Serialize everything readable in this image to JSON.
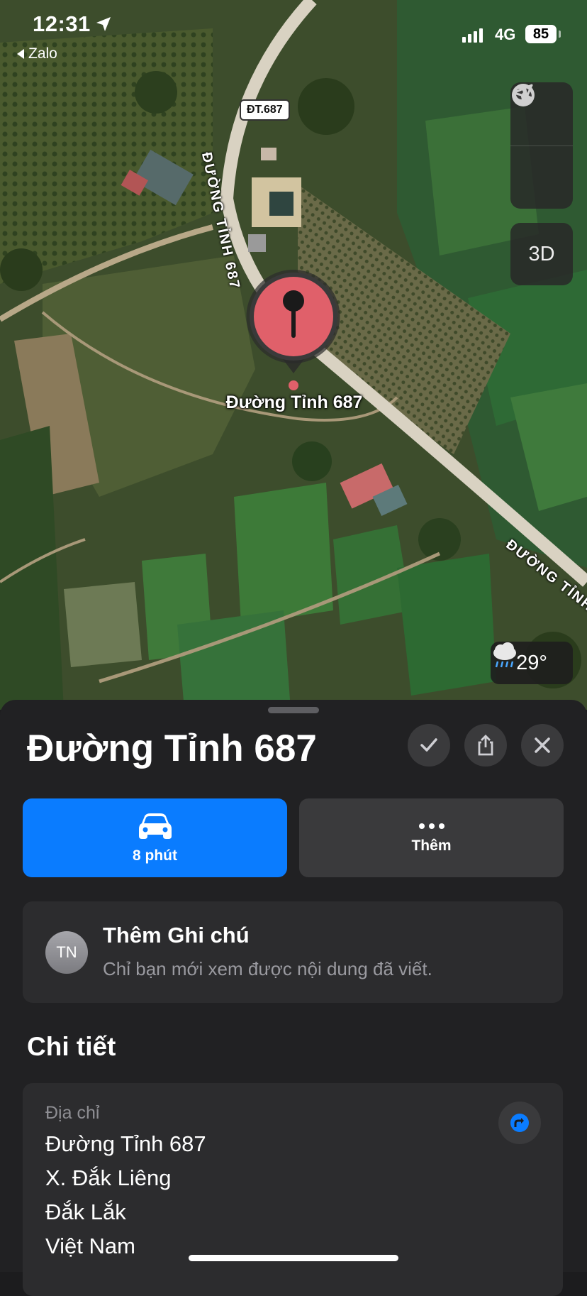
{
  "status_bar": {
    "time": "12:31",
    "back_app": "Zalo",
    "network": "4G",
    "battery": "85"
  },
  "map": {
    "road_shield": "ĐT.687",
    "road_label_1": "ĐƯỜNG TỈNH 687",
    "road_label_2": "ĐƯỜNG TỈNH",
    "pin_label": "Đường Tỉnh 687",
    "controls": {
      "globe_icon": "globe-icon",
      "locate_icon": "location-arrow-icon",
      "mode_3d": "3D"
    },
    "weather": {
      "icon": "rain-cloud-icon",
      "temperature": "29°"
    }
  },
  "sheet": {
    "title": "Đường Tỉnh 687",
    "header_buttons": [
      "checkmark-icon",
      "share-icon",
      "close-icon"
    ],
    "actions": {
      "drive_label": "8 phút",
      "more_label": "Thêm"
    },
    "note": {
      "avatar_initials": "TN",
      "title": "Thêm Ghi chú",
      "subtitle": "Chỉ bạn mới xem được nội dung đã viết."
    },
    "details": {
      "section_title": "Chi tiết",
      "address_label": "Địa chỉ",
      "address_lines": [
        "Đường Tỉnh 687",
        "X. Đắk Liêng",
        "Đắk Lắk",
        "Việt Nam"
      ]
    }
  },
  "colors": {
    "accent_blue": "#0a7cff",
    "pin_red": "#e0606a",
    "sheet_bg": "#212123",
    "card_bg": "#2c2c2e"
  }
}
